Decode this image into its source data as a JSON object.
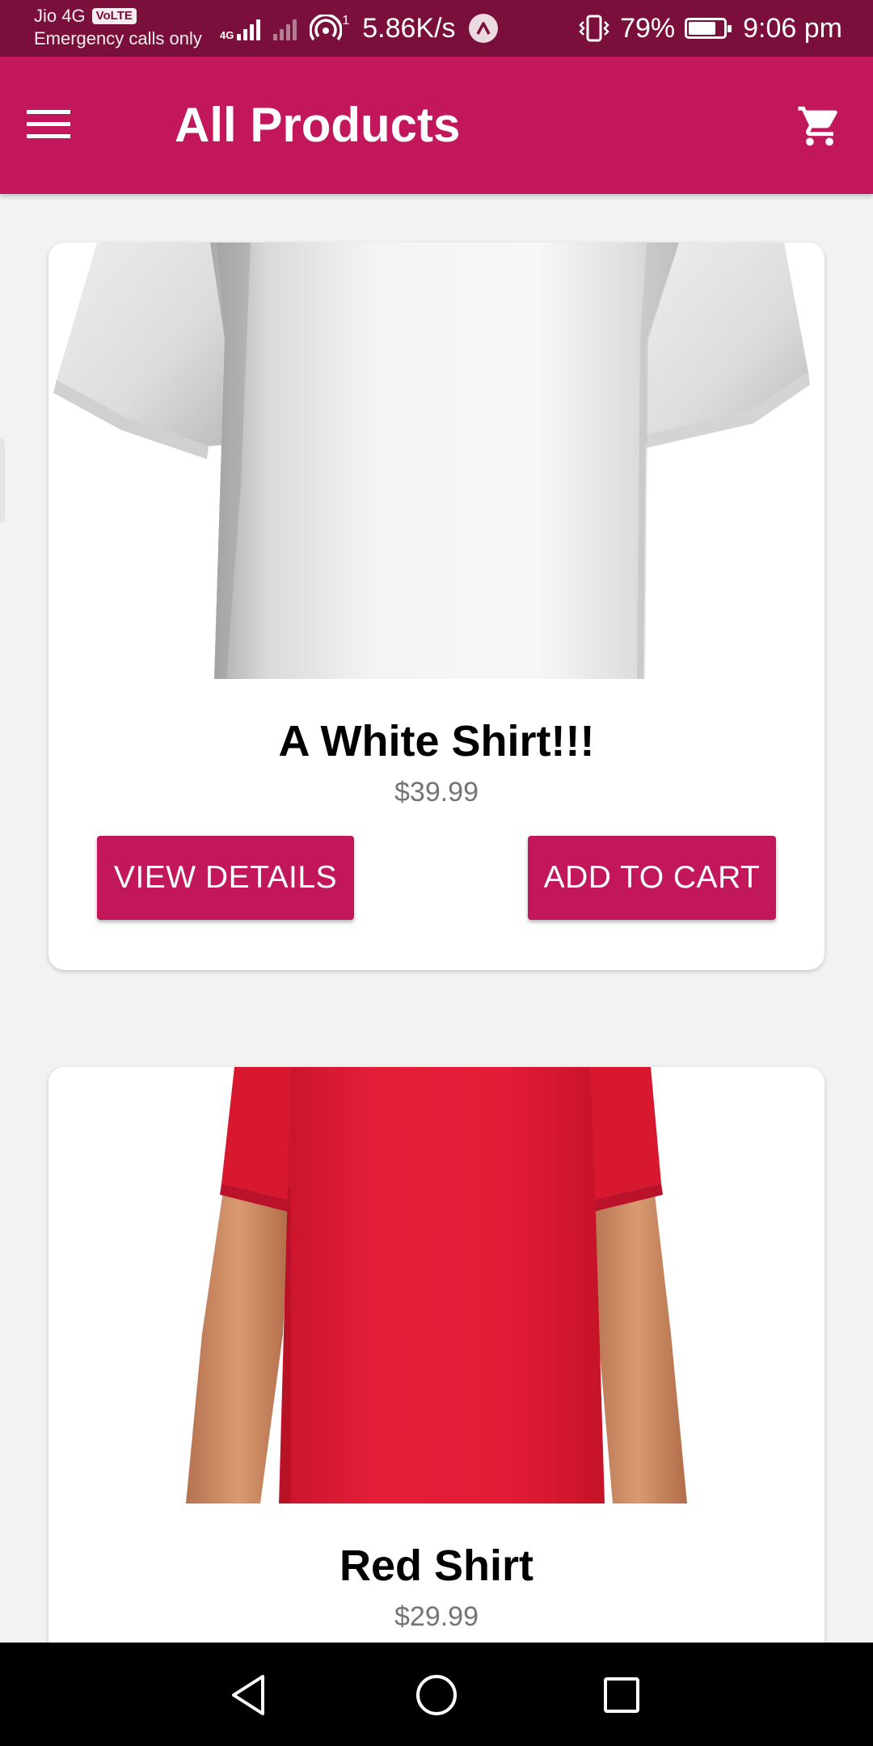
{
  "status_bar": {
    "carrier": "Jio 4G",
    "volte": "VoLTE",
    "emergency": "Emergency calls only",
    "network_type": "4G",
    "hotspot_count": "1",
    "speed": "5.86K/s",
    "battery_percent": "79%",
    "battery_level": 0.79,
    "time": "9:06 pm"
  },
  "app_bar": {
    "title": "All Products",
    "menu_icon": "hamburger-menu-icon",
    "cart_icon": "shopping-cart-icon"
  },
  "products": [
    {
      "name": "A White Shirt!!!",
      "price": "$39.99",
      "image": "white-t-shirt",
      "view_details_label": "VIEW DETAILS",
      "add_to_cart_label": "ADD TO CART"
    },
    {
      "name": "Red Shirt",
      "price": "$29.99",
      "image": "red-t-shirt"
    }
  ],
  "nav_bar": {
    "back_icon": "back-triangle-icon",
    "home_icon": "home-circle-icon",
    "recents_icon": "recents-square-icon"
  },
  "colors": {
    "primary": "#c2185b",
    "status_bar": "#790f3a",
    "background": "#f2f2f2",
    "price": "#757575",
    "red_shirt": "#e01e36"
  }
}
